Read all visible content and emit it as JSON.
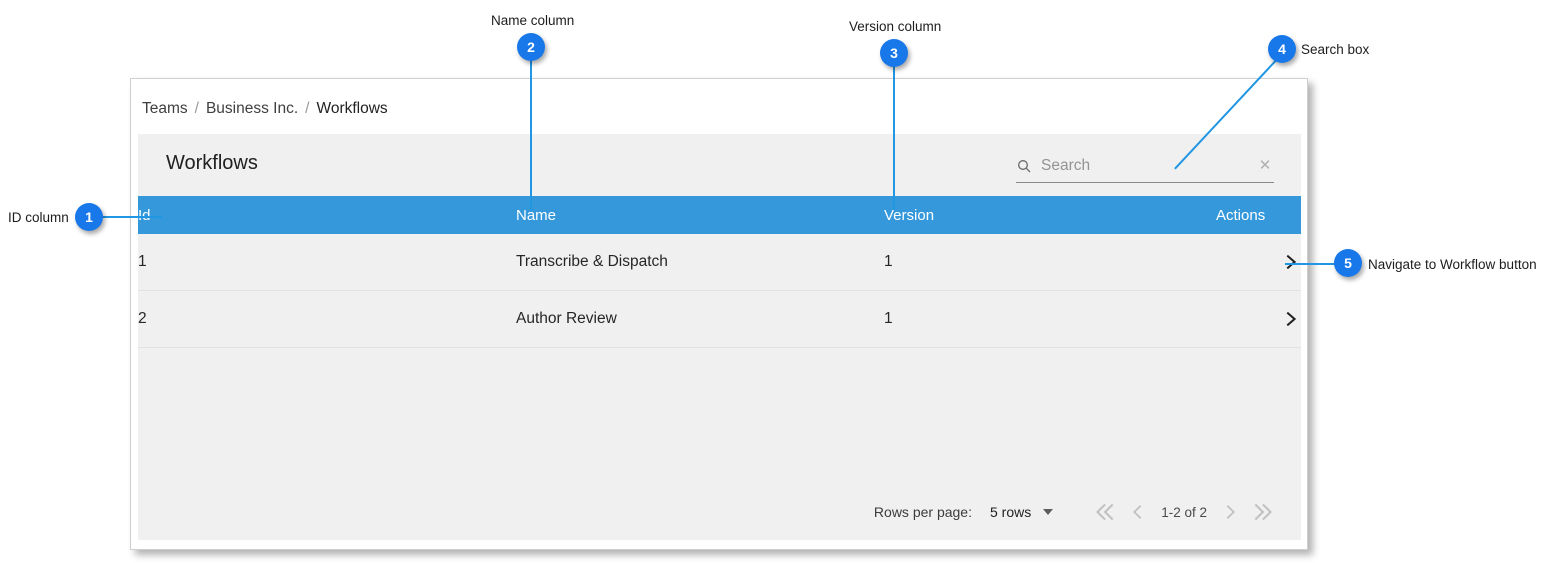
{
  "window": {
    "breadcrumb": {
      "items": [
        "Teams",
        "Business Inc.",
        "Workflows"
      ],
      "separator": "/"
    }
  },
  "card": {
    "title": "Workflows",
    "search": {
      "placeholder": "Search",
      "value": "",
      "icon": "search-icon",
      "clear_icon": "close-icon"
    },
    "table": {
      "columns": [
        "Id",
        "Name",
        "Version",
        "Actions"
      ],
      "rows": [
        {
          "id": "1",
          "name": "Transcribe & Dispatch",
          "version": "1",
          "action_icon": "chevron-right-icon"
        },
        {
          "id": "2",
          "name": "Author Review",
          "version": "1",
          "action_icon": "chevron-right-icon"
        }
      ]
    },
    "pagination": {
      "rows_per_page_label": "Rows per page:",
      "rows_per_page_value": "5 rows",
      "range": "1-2 of 2",
      "first_icon": "double-chevron-left-icon",
      "prev_icon": "chevron-left-icon",
      "next_icon": "chevron-right-icon",
      "last_icon": "double-chevron-right-icon"
    }
  },
  "annotations": [
    {
      "number": "1",
      "label": "ID column"
    },
    {
      "number": "2",
      "label": "Name column"
    },
    {
      "number": "3",
      "label": "Version column"
    },
    {
      "number": "4",
      "label": "Search box"
    },
    {
      "number": "5",
      "label": "Navigate to Workflow button"
    }
  ],
  "colors": {
    "header_blue": "#3498db",
    "badge_blue": "#1878ea",
    "leader_blue": "#2196e3",
    "card_gray": "#f0f0f0"
  }
}
